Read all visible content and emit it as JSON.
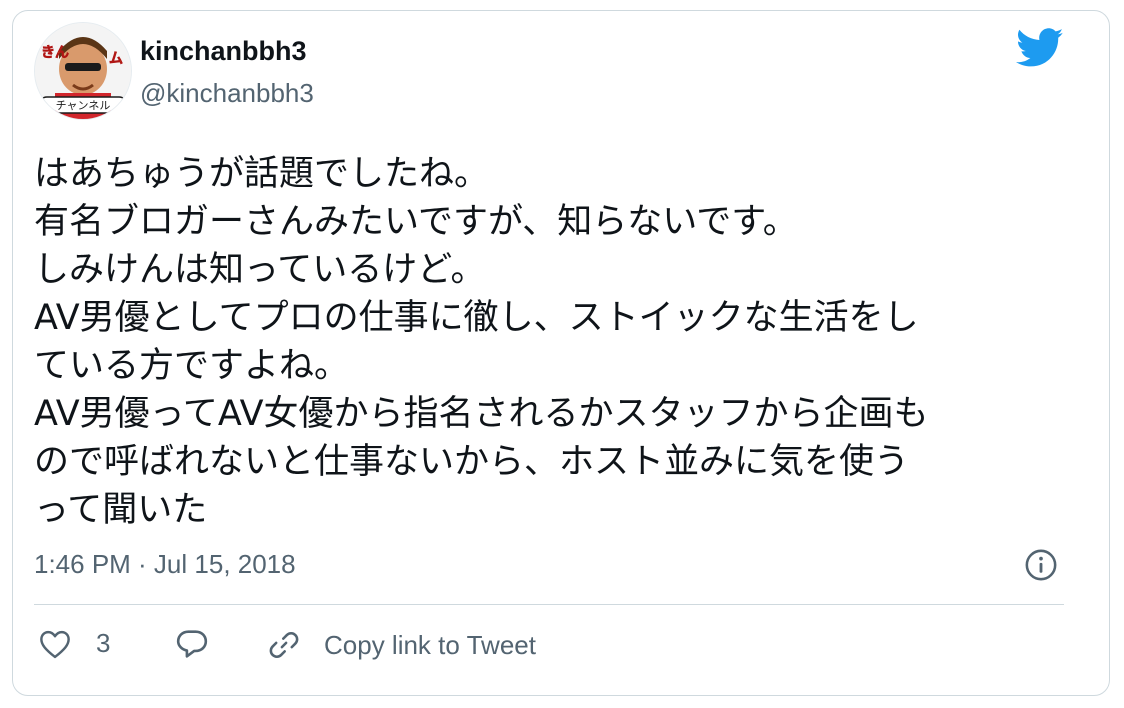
{
  "user": {
    "display_name": "kinchanbbh3",
    "handle": "@kinchanbbh3",
    "avatar_text": "きんちゃんチャンネル"
  },
  "tweet": {
    "lines": [
      "はあちゅうが話題でしたね。",
      "有名ブロガーさんみたいですが、知らないです。",
      "しみけんは知っているけど。",
      "AV男優としてプロの仕事に徹し、ストイックな生活をし",
      "ている方ですよね。",
      "AV男優ってAV女優から指名されるかスタッフから企画も",
      "ので呼ばれないと仕事ないから、ホスト並みに気を使う",
      "って聞いた"
    ],
    "timestamp": "1:46 PM · Jul 15, 2018"
  },
  "actions": {
    "like_count": "3",
    "copy_link_label": "Copy link to Tweet"
  },
  "icons": {
    "brand": "twitter-bird-icon",
    "info": "info-icon",
    "like": "heart-icon",
    "reply": "reply-bubble-icon",
    "copy": "link-icon"
  },
  "colors": {
    "twitter_blue": "#1d9bf0",
    "text": "#0f1419",
    "secondary": "#536471",
    "border": "#cfd9de"
  }
}
